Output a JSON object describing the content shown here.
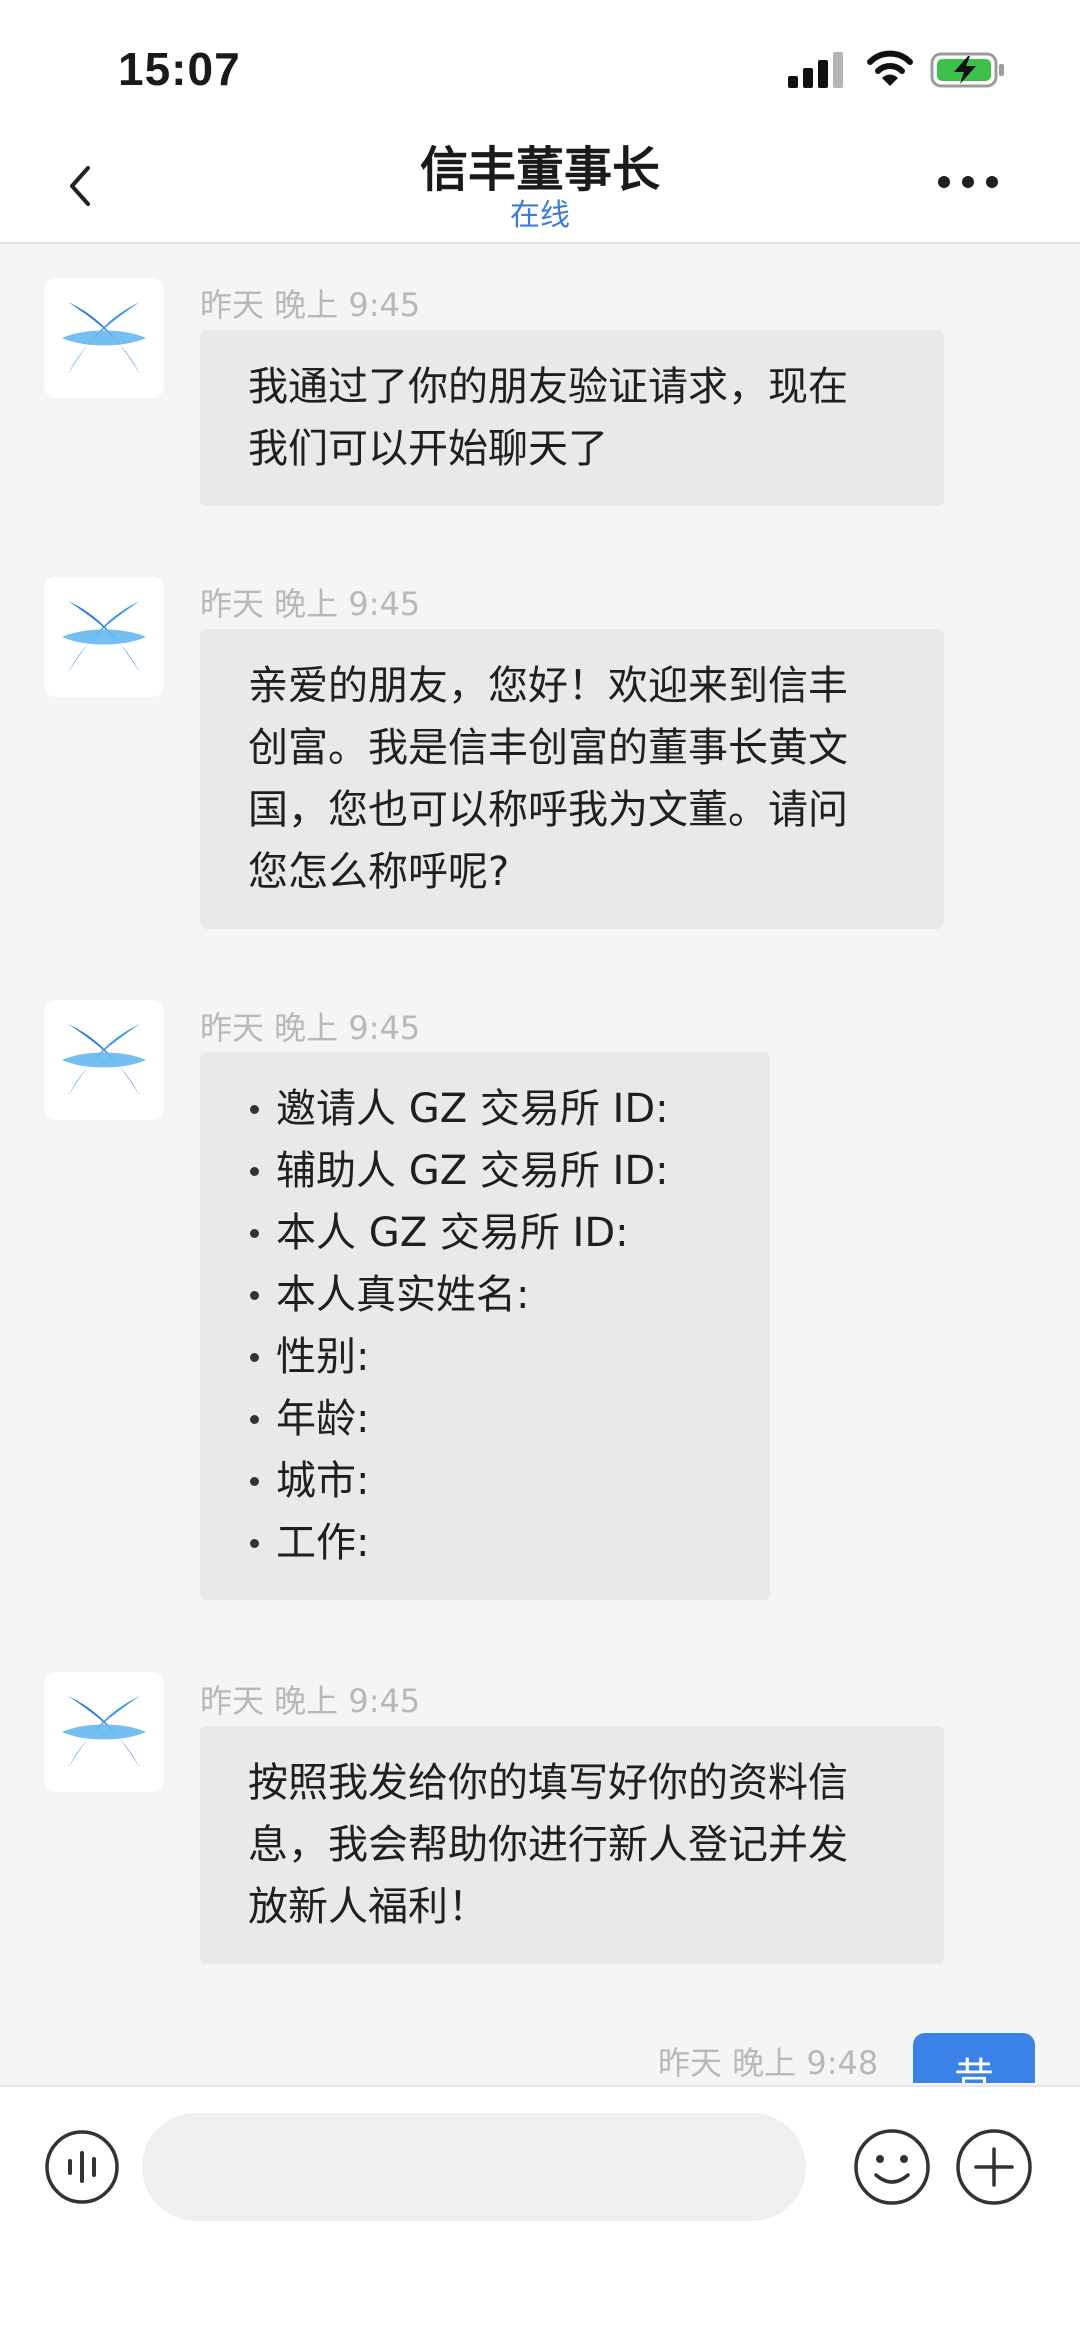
{
  "status_bar": {
    "time": "15:07",
    "icons": [
      "signal-icon",
      "wifi-icon",
      "battery-charging-icon"
    ]
  },
  "header": {
    "title": "信丰董事长",
    "subtitle": "在线",
    "back_icon": "chevron-left-icon",
    "more_icon": "more-horizontal-icon"
  },
  "colors": {
    "accent": "#3b7ed6",
    "bubble_received": "#e9e9e9",
    "bubble_sent": "#3b82e8",
    "background": "#f5f5f5",
    "avatar_logo": "#2f7fd8"
  },
  "messages": [
    {
      "time": "昨天 晚上 9:45",
      "text": "我通过了你的朋友验证请求，现在\n我们可以开始聊天了"
    },
    {
      "time": "昨天 晚上 9:45",
      "text": "亲爱的朋友，您好！欢迎来到信丰\n创富。我是信丰创富的董事长黄文\n国，您也可以称呼我为文董。请问\n您怎么称呼呢?"
    },
    {
      "time": "昨天 晚上 9:45",
      "items": [
        "邀请人 GZ 交易所 ID:",
        "辅助人 GZ 交易所 ID:",
        "本人 GZ 交易所 ID:",
        "本人真实姓名:",
        "性别:",
        "年龄:",
        "城市:",
        "工作:"
      ]
    },
    {
      "time": "昨天 晚上 9:45",
      "text": "按照我发给你的填写好你的资料信\n息，我会帮助你进行新人登记并发\n放新人福利！"
    },
    {
      "time": "昨天 晚上 9:48",
      "sent": true,
      "text": "昔"
    }
  ],
  "input_bar": {
    "placeholder": "",
    "icons": [
      "voice-icon",
      "emoji-icon",
      "plus-icon"
    ]
  }
}
